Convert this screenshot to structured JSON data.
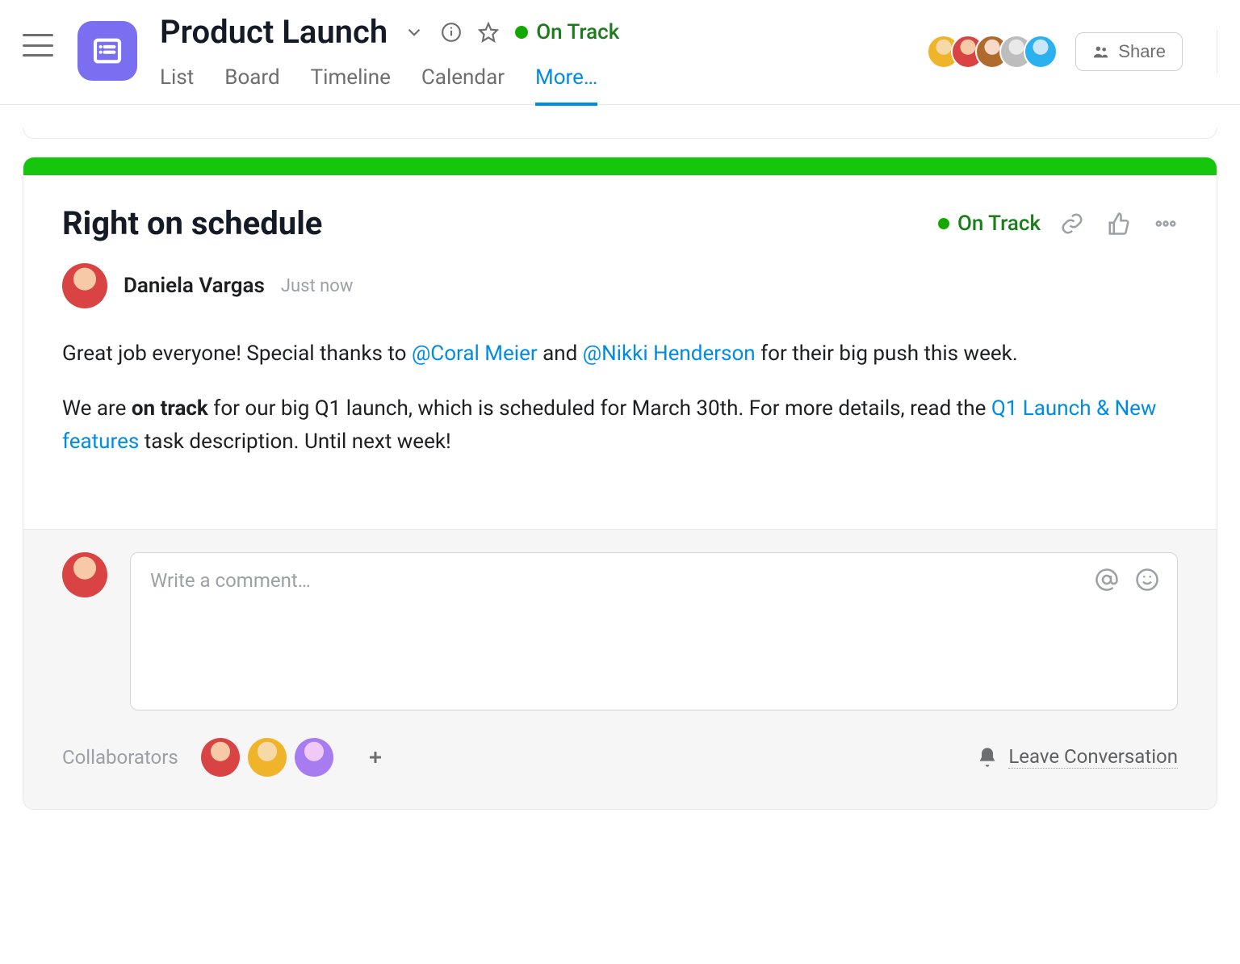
{
  "header": {
    "title": "Product Launch",
    "status_text": "On Track",
    "tabs": [
      "List",
      "Board",
      "Timeline",
      "Calendar",
      "More…"
    ],
    "active_tab_index": 4,
    "share_label": "Share"
  },
  "status_update": {
    "title": "Right on schedule",
    "status_text": "On Track",
    "author": "Daniela Vargas",
    "timestamp": "Just now",
    "body": {
      "p1_pre": "Great job everyone! Special thanks to ",
      "mention1": "@Coral Meier",
      "p1_mid": " and ",
      "mention2": "@Nikki Henderson",
      "p1_post": " for their big push this week.",
      "p2_pre": "We are ",
      "bold1": "on track",
      "p2_mid": " for our big Q1 launch, which is scheduled for March 30th. For more details, read the ",
      "link1": "Q1 Launch & New features",
      "p2_post": " task description. Until next week!"
    }
  },
  "comment": {
    "placeholder": "Write a comment…"
  },
  "collaborators": {
    "label": "Collaborators",
    "leave_label": "Leave Conversation"
  }
}
